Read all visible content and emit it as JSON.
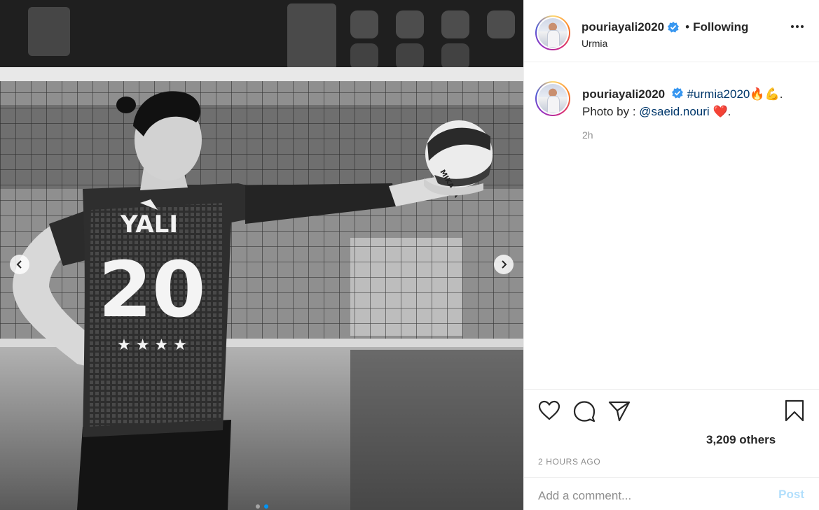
{
  "post": {
    "username": "pouriayali2020",
    "separator": "•",
    "follow_status": "Following",
    "location": "Urmia"
  },
  "photo": {
    "jersey_name": "YALI",
    "jersey_number": "20",
    "ball_brand": "MIKASA",
    "slide_count": 2,
    "active_slide": 1
  },
  "caption": {
    "username": "pouriayali2020",
    "hashtag": "#urmia2020",
    "emoji_1": "🔥💪",
    "period_1": ".",
    "line2_prefix": "Photo by : ",
    "mention": "@saeid.nouri",
    "emoji_2": "❤️",
    "period_2": ".",
    "age": "2h"
  },
  "engagement": {
    "likes_text": "3,209 others",
    "time_ago": "2 HOURS AGO"
  },
  "comment": {
    "placeholder": "Add a comment...",
    "post_label": "Post"
  },
  "icons": {
    "verified": "verified-badge-icon",
    "like": "heart-icon",
    "comment": "comment-bubble-icon",
    "share": "paper-plane-icon",
    "save": "bookmark-icon",
    "more": "ellipsis-icon",
    "prev": "chevron-left-icon",
    "next": "chevron-right-icon"
  },
  "colors": {
    "verified": "#3897f0",
    "link": "#00376b",
    "post_disabled": "#b2dffc",
    "active_dot": "#0095f6"
  }
}
